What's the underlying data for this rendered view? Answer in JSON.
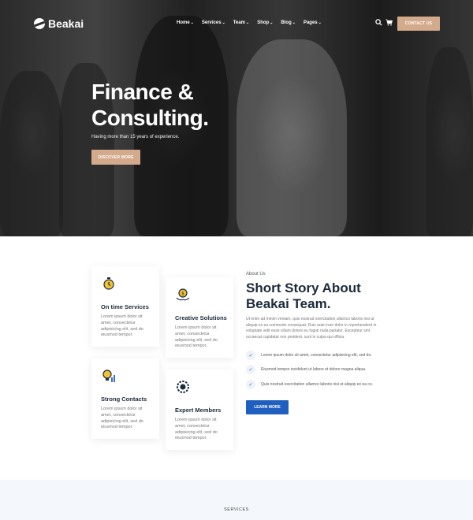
{
  "nav": {
    "logo_text": "Beakai",
    "menu": [
      {
        "label": "Home"
      },
      {
        "label": "Services"
      },
      {
        "label": "Team"
      },
      {
        "label": "Shop"
      },
      {
        "label": "Blog"
      },
      {
        "label": "Pages"
      }
    ],
    "contact_label": "CONTACT US"
  },
  "hero": {
    "title_line1": "Finance &",
    "title_line2": "Consulting.",
    "subtitle": "Having more than 15 years of experience.",
    "cta_label": "DISCOVER MORE"
  },
  "features": [
    {
      "title": "On time Services",
      "body": "Lorem ipsum dolor sit amet, consectetur adipisicing elit, sed do eiusmod tempor."
    },
    {
      "title": "Creative Solutions",
      "body": "Lorem ipsum dolor sit amet, consectetur adipisicing elit, sed do eiusmod tempor."
    },
    {
      "title": "Strong Contacts",
      "body": "Lorem ipsum dolor sit amet, consectetur adipisicing elit, sed do eiusmod tempor."
    },
    {
      "title": "Expert Members",
      "body": "Lorem ipsum dolor sit amet, consectetur adipisicing elit, sed do eiusmod tempor."
    }
  ],
  "about": {
    "label": "About Us",
    "title": "Short Story About Beakai Team.",
    "body": "Ut enim ad minim veniam, quis nostrud exercitation ullamco laboris nisi ut aliquip ex ea commodo consequat. Duis aute irure dolor in reprehenderit in voluptate velit esse cillum dolore eu fugiat nulla pariatur. Excepteur sint occaecat cupidatat non proident, sunt in culpa qui officia.",
    "checks": [
      "Lorem ipsum dolor sit amet, consectetur adipisicing elit, sed do.",
      "Eiusmod tempor incididunt ut labore et dolore magna aliqua.",
      "Quis nostrud exercitation ullamco laboris nisi ut aliquip ex ea co."
    ],
    "cta_label": "LEARN MORE"
  },
  "services": {
    "label": "SERVICES"
  },
  "colors": {
    "accent": "#d4aa8c",
    "primary": "#1f5fbf",
    "heading": "#1b2a3d"
  }
}
